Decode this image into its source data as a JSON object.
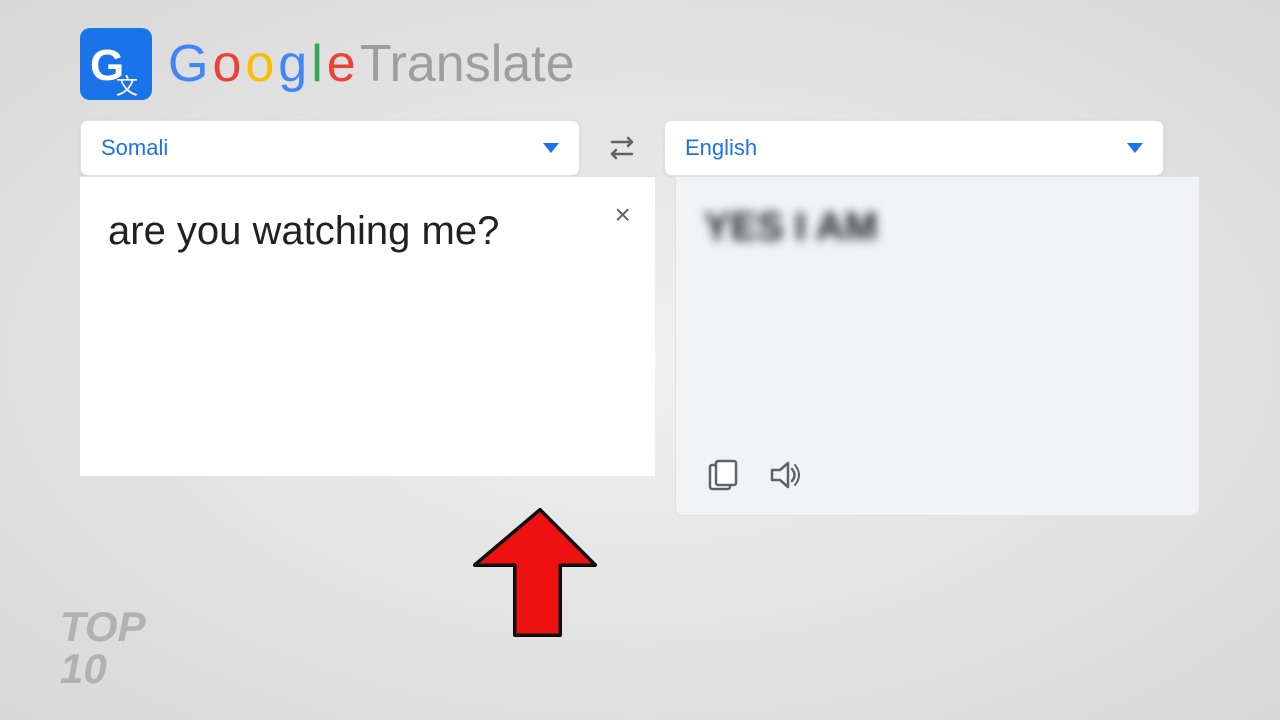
{
  "header": {
    "logo_alt": "Google Translate",
    "google_letters": [
      "G",
      "o",
      "o",
      "g",
      "l",
      "e"
    ],
    "translate_label": "Translate"
  },
  "source_language": {
    "label": "Somali",
    "dropdown_icon": "chevron-down"
  },
  "target_language": {
    "label": "English",
    "dropdown_icon": "chevron-down"
  },
  "source_text": "are you watching me?",
  "translated_text": "YES I AM",
  "clear_button_label": "×",
  "swap_icon": "⇄",
  "copy_icon": "copy",
  "speaker_icon": "speaker",
  "watermark": "TOP\n10"
}
